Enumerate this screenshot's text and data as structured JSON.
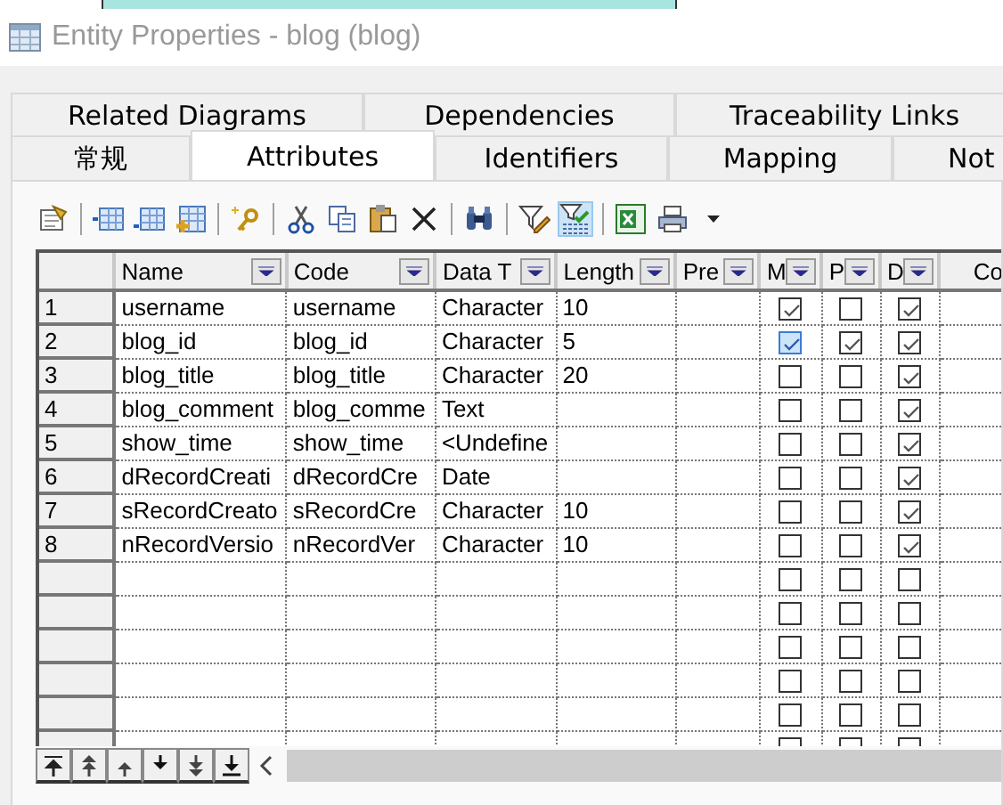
{
  "window": {
    "title": "Entity Properties - blog (blog)"
  },
  "tab_rows": [
    {
      "tabs": [
        {
          "label": "Related Diagrams",
          "selected": false
        },
        {
          "label": "Dependencies",
          "selected": false
        },
        {
          "label": "Traceability Links",
          "selected": false
        }
      ]
    },
    {
      "tabs": [
        {
          "label": "常规",
          "selected": false
        },
        {
          "label": "Attributes",
          "selected": true
        },
        {
          "label": "Identifiers",
          "selected": false
        },
        {
          "label": "Mapping",
          "selected": false
        },
        {
          "label": "Not",
          "selected": false
        }
      ]
    }
  ],
  "toolbar": [
    {
      "kind": "properties",
      "selected": false
    },
    {
      "kind": "separator"
    },
    {
      "kind": "insert",
      "selected": false
    },
    {
      "kind": "add",
      "selected": false
    },
    {
      "kind": "add-many",
      "selected": false
    },
    {
      "kind": "separator"
    },
    {
      "kind": "key",
      "selected": false
    },
    {
      "kind": "separator"
    },
    {
      "kind": "cut",
      "selected": false
    },
    {
      "kind": "copy",
      "selected": false
    },
    {
      "kind": "paste",
      "selected": false
    },
    {
      "kind": "delete",
      "selected": false
    },
    {
      "kind": "separator"
    },
    {
      "kind": "find",
      "selected": false
    },
    {
      "kind": "separator"
    },
    {
      "kind": "filter-edit",
      "selected": false
    },
    {
      "kind": "filter-apply",
      "selected": true
    },
    {
      "kind": "separator"
    },
    {
      "kind": "excel",
      "selected": false
    },
    {
      "kind": "print",
      "selected": false
    },
    {
      "kind": "caret",
      "selected": false
    }
  ],
  "table": {
    "columns": [
      {
        "label": "Name",
        "dropdown": true
      },
      {
        "label": "Code",
        "dropdown": true
      },
      {
        "label": "Data T",
        "dropdown": true
      },
      {
        "label": "Length",
        "dropdown": true
      },
      {
        "label": "Pre",
        "dropdown": true
      },
      {
        "label": "M",
        "dropdown": true
      },
      {
        "label": "P",
        "dropdown": true
      },
      {
        "label": "D",
        "dropdown": true
      },
      {
        "label": "Co",
        "dropdown": false
      }
    ],
    "rows": [
      {
        "number": "1",
        "name": "username",
        "code": "username",
        "data_type": "Character",
        "length": "10",
        "m": true,
        "p": false,
        "d": true,
        "focused": false
      },
      {
        "number": "2",
        "name": "blog_id",
        "code": "blog_id",
        "data_type": "Character",
        "length": "5",
        "m": true,
        "p": true,
        "d": true,
        "focused": true
      },
      {
        "number": "3",
        "name": "blog_title",
        "code": "blog_title",
        "data_type": "Character",
        "length": "20",
        "m": false,
        "p": false,
        "d": true,
        "focused": false
      },
      {
        "number": "4",
        "name": "blog_comment",
        "code": "blog_comme",
        "data_type": "Text",
        "m": false,
        "p": false,
        "d": true,
        "focused": false
      },
      {
        "number": "5",
        "name": "show_time",
        "code": "show_time",
        "data_type": "<Undefine",
        "m": false,
        "p": false,
        "d": true,
        "focused": false
      },
      {
        "number": "6",
        "name": "dRecordCreati",
        "code": "dRecordCre",
        "data_type": "Date",
        "m": false,
        "p": false,
        "d": true,
        "focused": false
      },
      {
        "number": "7",
        "name": "sRecordCreato",
        "code": "sRecordCre",
        "data_type": "Character",
        "length": "10",
        "m": false,
        "p": false,
        "d": true,
        "focused": false
      },
      {
        "number": "8",
        "name": "nRecordVersio",
        "code": "nRecordVer",
        "data_type": "Character",
        "length": "10",
        "m": false,
        "p": false,
        "d": true,
        "focused": false
      },
      {
        "m": false,
        "p": false,
        "d": false,
        "focused": false
      },
      {
        "m": false,
        "p": false,
        "d": false,
        "focused": false
      },
      {
        "m": false,
        "p": false,
        "d": false,
        "focused": false
      },
      {
        "m": false,
        "p": false,
        "d": false,
        "focused": false
      },
      {
        "m": false,
        "p": false,
        "d": false,
        "focused": false
      },
      {
        "m": false,
        "p": false,
        "d": false,
        "focused": false
      }
    ]
  },
  "navigation": [
    {
      "kind": "first"
    },
    {
      "kind": "page-up"
    },
    {
      "kind": "up"
    },
    {
      "kind": "down"
    },
    {
      "kind": "page-down"
    },
    {
      "kind": "last"
    }
  ]
}
